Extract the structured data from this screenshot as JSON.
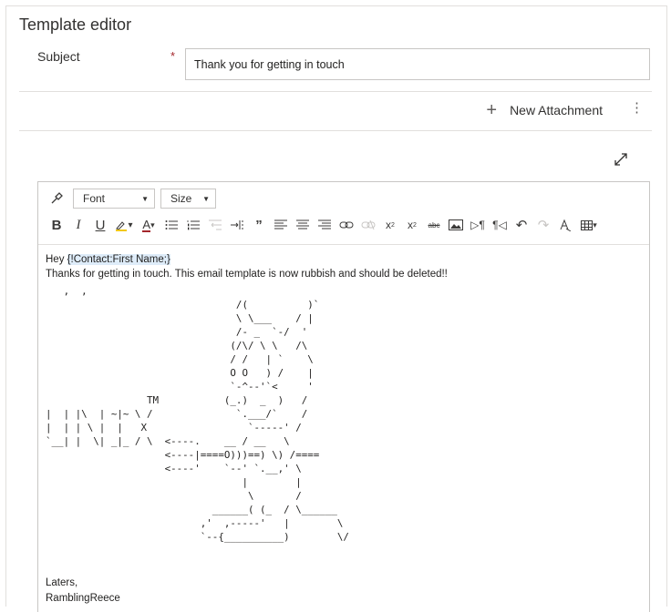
{
  "header": {
    "title": "Template editor"
  },
  "subject": {
    "label": "Subject",
    "required_mark": "*",
    "value": "Thank you for getting in touch"
  },
  "attachments": {
    "new_label": "New Attachment",
    "plus_icon": "plus-icon",
    "more_icon": "more-vertical-icon"
  },
  "toolbar": {
    "font_label": "Font",
    "size_label": "Size",
    "buttons": [
      "format-painter",
      "bold",
      "italic",
      "underline",
      "highlight",
      "font-color",
      "bullet-list",
      "numbered-list",
      "decrease-indent",
      "increase-indent",
      "quote",
      "align-left",
      "align-center",
      "align-right",
      "link",
      "unlink",
      "superscript",
      "subscript",
      "strikethrough",
      "image",
      "ltr",
      "rtl",
      "undo",
      "redo",
      "clear-format",
      "table"
    ]
  },
  "body": {
    "greeting_prefix": "Hey ",
    "placeholder": "{!Contact:First Name;}",
    "line1": " Thanks for getting in touch. This email template is now rubbish and should be deleted!!",
    "ascii_art": "   ,  ,                                                                  \n                                /(          )`\n                                \\ \\___    / |\n                                /- _  `-/  '\n                               (/\\/ \\ \\   /\\\n                               / /   | `    \\\n                               O O   ) /    |\n                               `-^--'`<     '\n                 TM           (_.)  _  )   /\n|  | |\\  | ~|~ \\ /              `.___/`    /\n|  | | \\ |  |   X                 `-----' /\n`__| |  \\| _|_ / \\  <----.    __ / __   \\\n                    <----|====O)))==) \\) /====\n                    <----'    `--' `.__,' \\\n                                 |        |\n                                  \\       /\n                            ______( (_  / \\______\n                          ,'  ,-----'   |        \\\n                          `--{__________)        \\/",
    "signoff_1": "Laters,",
    "signoff_2": "RamblingReece"
  },
  "colors": {
    "required": "#a4262c",
    "placeholder_bg": "#deecf9",
    "border": "#c8c6c4"
  }
}
